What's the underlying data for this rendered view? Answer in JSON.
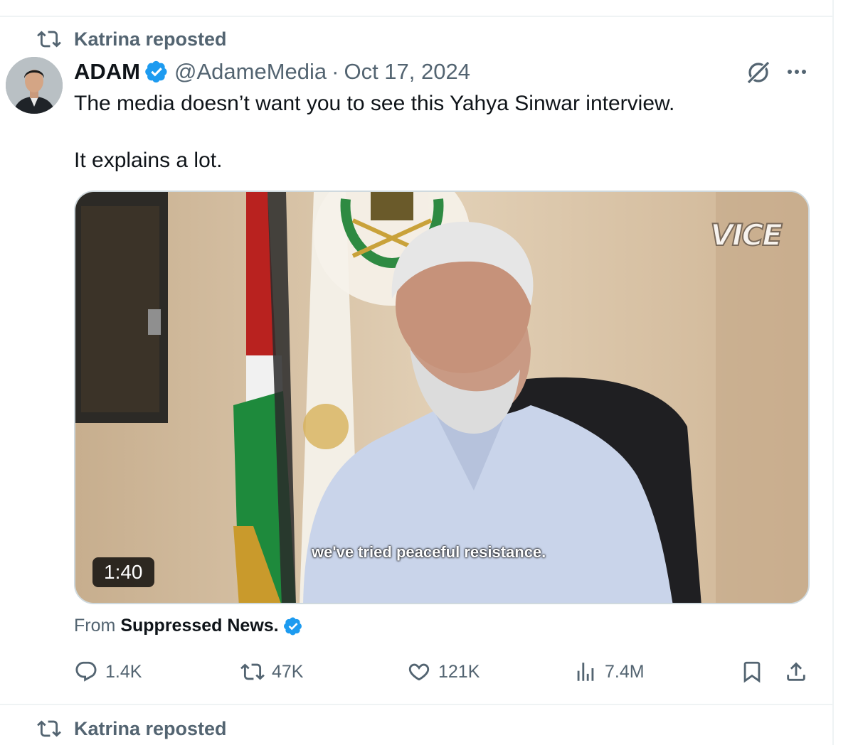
{
  "repost_banner": {
    "label": "Katrina reposted"
  },
  "tweet": {
    "author_name": "ADAM",
    "handle": "@AdameMedia",
    "separator": "·",
    "date": "Oct 17, 2024",
    "text": "The media doesn’t want you to see this Yahya Sinwar interview.\n\nIt explains a lot.",
    "video": {
      "duration": "1:40",
      "caption": "we've tried peaceful resistance.",
      "watermark": "VICE"
    },
    "attribution": {
      "prefix": "From",
      "source": "Suppressed News."
    },
    "metrics": {
      "replies": "1.4K",
      "reposts": "47K",
      "likes": "121K",
      "views": "7.4M"
    }
  },
  "next_repost_banner": {
    "label": "Katrina reposted"
  },
  "colors": {
    "verified": "#1d9bf0",
    "secondary_text": "#536471",
    "border": "#eff3f4"
  },
  "icons": [
    "repost-icon",
    "verified-badge-icon",
    "grok-icon",
    "more-icon",
    "reply-icon",
    "like-icon",
    "views-icon",
    "bookmark-icon",
    "share-icon"
  ]
}
